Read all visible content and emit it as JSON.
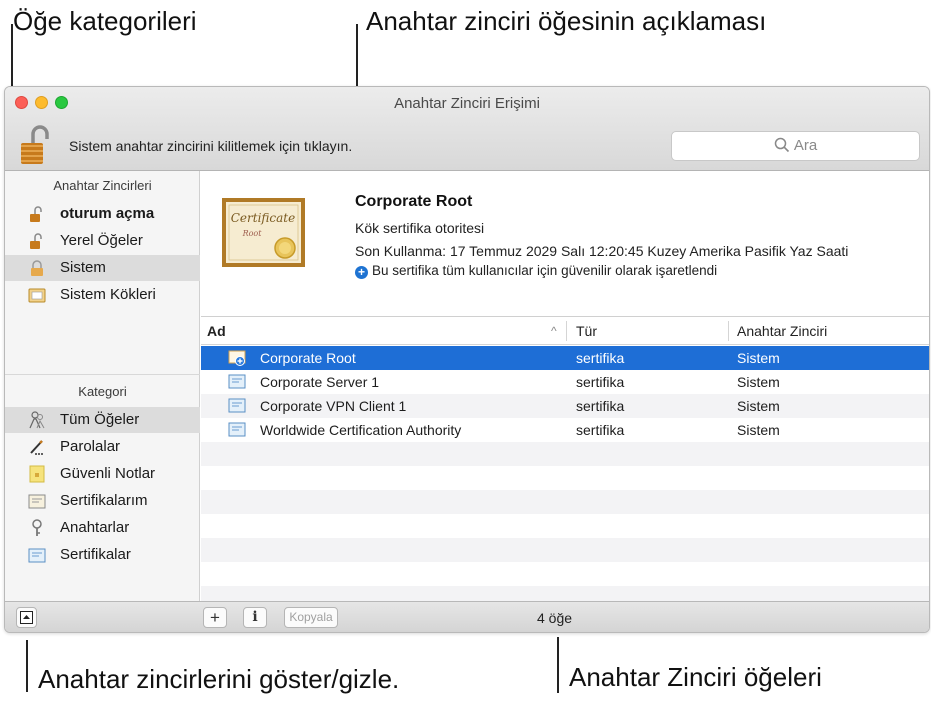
{
  "callouts": {
    "categories": "Öğe kategorileri",
    "description": "Anahtar zinciri öğesinin açıklaması",
    "toggle": "Anahtar zincirlerini göster/gizle.",
    "items": "Anahtar Zinciri öğeleri"
  },
  "window": {
    "title": "Anahtar Zinciri Erişimi",
    "lock_text": "Sistem anahtar zincirini kilitlemek için tıklayın.",
    "search_placeholder": "Ara"
  },
  "sidebar": {
    "keychains_header": "Anahtar Zincirleri",
    "keychains": [
      {
        "label": "oturum açma",
        "icon": "lock-open-icon"
      },
      {
        "label": "Yerel Öğeler",
        "icon": "lock-open-icon"
      },
      {
        "label": "Sistem",
        "icon": "lock-open-icon",
        "selected": true
      },
      {
        "label": "Sistem Kökleri",
        "icon": "folder-cert-icon"
      }
    ],
    "category_header": "Kategori",
    "categories": [
      {
        "label": "Tüm Öğeler",
        "icon": "people-icon",
        "selected": true
      },
      {
        "label": "Parolalar",
        "icon": "pencil-icon"
      },
      {
        "label": "Güvenli Notlar",
        "icon": "note-icon"
      },
      {
        "label": "Sertifikalarım",
        "icon": "cert-icon"
      },
      {
        "label": "Anahtarlar",
        "icon": "key-icon"
      },
      {
        "label": "Sertifikalar",
        "icon": "cert-icon"
      }
    ]
  },
  "detail": {
    "cert_script": "Certificate",
    "cert_sub": "Root",
    "title": "Corporate Root",
    "kind": "Kök sertifika otoritesi",
    "expiry": "Son Kullanma: 17 Temmuz 2029 Salı 12:20:45 Kuzey Amerika Pasifik Yaz Saati",
    "trust": "Bu sertifika tüm kullanıcılar için güvenilir olarak işaretlendi"
  },
  "table": {
    "columns": [
      "Ad",
      "Tür",
      "Anahtar Zinciri"
    ],
    "sort_indicator": "^",
    "rows": [
      {
        "name": "Corporate Root",
        "kind": "sertifika",
        "keychain": "Sistem",
        "selected": true
      },
      {
        "name": "Corporate Server 1",
        "kind": "sertifika",
        "keychain": "Sistem"
      },
      {
        "name": "Corporate VPN Client 1",
        "kind": "sertifika",
        "keychain": "Sistem"
      },
      {
        "name": "Worldwide Certification Authority",
        "kind": "sertifika",
        "keychain": "Sistem"
      }
    ]
  },
  "bottombar": {
    "add_label": "+",
    "info_label": "i",
    "copy_label": "Kopyala",
    "count": "4 öğe"
  },
  "colors": {
    "selection": "#1e6ed6",
    "sidebar_bg": "#f5f5f5"
  }
}
